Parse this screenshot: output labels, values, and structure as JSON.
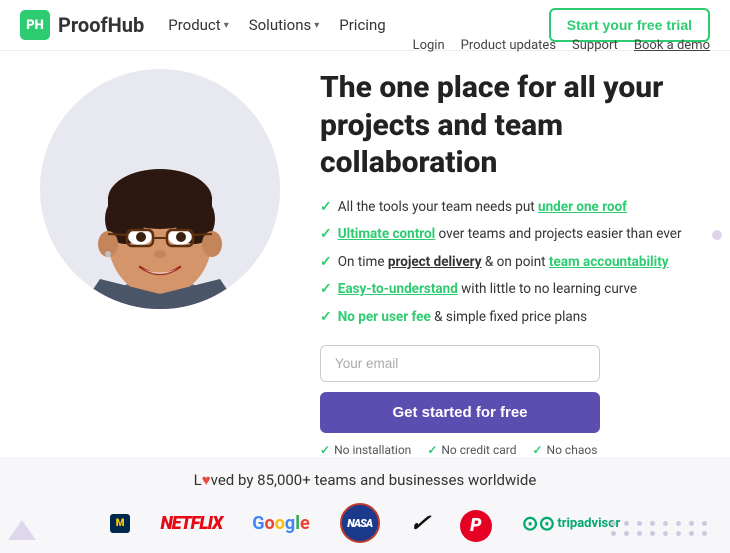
{
  "navbar": {
    "logo_text": "ProofHub",
    "logo_initials": "PH",
    "nav_items": [
      {
        "label": "Product",
        "has_arrow": true
      },
      {
        "label": "Solutions",
        "has_arrow": true
      },
      {
        "label": "Pricing",
        "has_arrow": false
      }
    ],
    "cta_label": "Start your free trial",
    "secondary_links": [
      {
        "label": "Login"
      },
      {
        "label": "Product updates"
      },
      {
        "label": "Support"
      },
      {
        "label": "Book a demo"
      }
    ]
  },
  "hero": {
    "title": "The one place for all your projects and team collaboration",
    "features": [
      {
        "text_before": "All the tools your team needs put ",
        "highlight": "under one roof",
        "highlight_type": "green-underline",
        "text_after": ""
      },
      {
        "text_before": "",
        "highlight": "Ultimate control",
        "highlight_type": "green-underline",
        "text_after": " over teams and projects easier than ever"
      },
      {
        "text_before": "On time ",
        "highlight": "project delivery",
        "highlight_type": "underline",
        "text_mid": " & on point ",
        "highlight2": "team accountability",
        "highlight2_type": "green-underline",
        "text_after": ""
      },
      {
        "text_before": "",
        "highlight": "Easy-to-understand",
        "highlight_type": "green-underline",
        "text_after": " with little to no learning curve"
      },
      {
        "text_before": "",
        "highlight": "No per user fee",
        "highlight_type": "green-plain",
        "text_after": " & simple fixed price plans"
      }
    ],
    "email_placeholder": "Your email",
    "cta_button": "Get started for free",
    "sub_badges": [
      "No installation",
      "No credit card",
      "No chaos"
    ]
  },
  "bottom": {
    "loved_text_before": "L",
    "loved_heart": "♥",
    "loved_text_after": "ved by 85,000+ teams and businesses worldwide",
    "logos": [
      {
        "name": "Michigan",
        "type": "michigan"
      },
      {
        "name": "NETFLIX",
        "type": "netflix"
      },
      {
        "name": "Google",
        "type": "google"
      },
      {
        "name": "NASA",
        "type": "nasa"
      },
      {
        "name": "Nike",
        "type": "nike"
      },
      {
        "name": "Pinterest",
        "type": "pinterest"
      },
      {
        "name": "tripadvisor",
        "type": "tripadvisor"
      }
    ]
  },
  "colors": {
    "green": "#2ecc71",
    "purple": "#5c4db1",
    "red": "#e74c3c"
  }
}
